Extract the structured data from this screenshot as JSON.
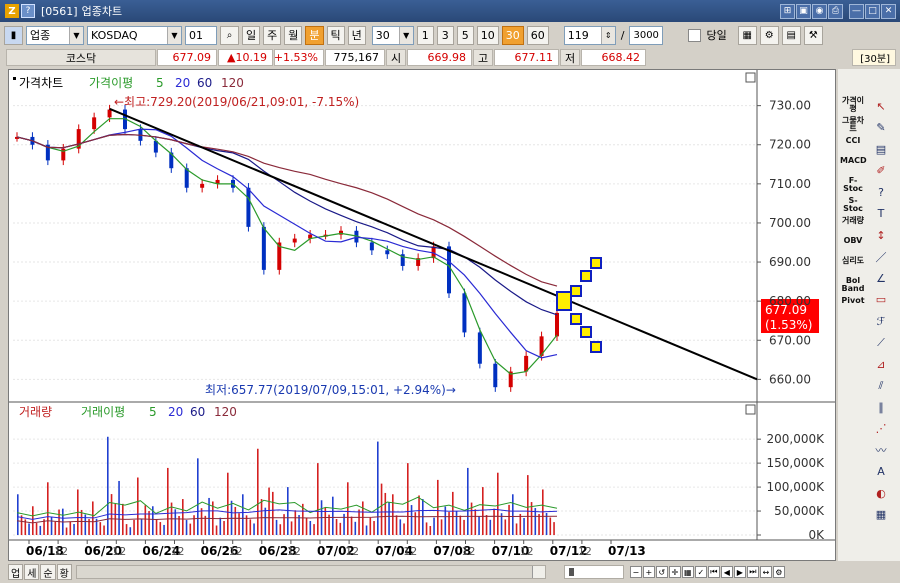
{
  "window": {
    "screen_code": "[0561]",
    "title": "업종차트",
    "logo": "Z",
    "logo2": "?"
  },
  "toolbar": {
    "market_select": "업종",
    "index_select": "KOSDAQ",
    "code_value": "01",
    "periods": [
      "일",
      "주",
      "월",
      "분",
      "틱",
      "년"
    ],
    "active_period": "분",
    "interval_value": "30",
    "intervals": [
      "1",
      "3",
      "5",
      "10",
      "30",
      "60"
    ],
    "active_interval": "30",
    "count_value": "119",
    "slash": "/",
    "total_value": "3000",
    "same_day_label": "당일"
  },
  "pricebar": {
    "name": "코스닥",
    "price": "677.09",
    "change": "▲10.19",
    "change_pct": "+1.53%",
    "volume": "775,167",
    "open_label": "시",
    "open": "669.98",
    "high_label": "고",
    "high": "677.11",
    "low_label": "저",
    "low": "668.42",
    "interval_badge": "[30분]"
  },
  "price_chart": {
    "legend_title": "가격차트",
    "ma_title": "가격이평",
    "ma_periods": [
      "5",
      "20",
      "60",
      "120"
    ],
    "ma_colors": [
      "#2a9a2a",
      "#2a2ad4",
      "#1a1a88",
      "#8a2a3a"
    ],
    "y_ticks": [
      "730.00",
      "720.00",
      "710.00",
      "700.00",
      "690.00",
      "680.00",
      "670.00",
      "660.00"
    ],
    "high_annotation": "←최고:729.20(2019/06/21,09:01, -7.15%)",
    "low_annotation": "최저:657.77(2019/07/09,15:01, +2.94%)→",
    "current_price_label": "677.09",
    "current_pct_label": "(1.53%)"
  },
  "volume_chart": {
    "legend_title": "거래량",
    "ma_title": "거래이평",
    "ma_periods": [
      "5",
      "20",
      "60",
      "120"
    ],
    "y_ticks": [
      "200,000K",
      "150,000K",
      "100,000K",
      "50,000K",
      "0K"
    ]
  },
  "x_axis": {
    "labels": [
      "06/18",
      "12",
      "06/20",
      "12",
      "06/24",
      "12",
      "06/26",
      "12",
      "06/28",
      "12",
      "07/02",
      "12",
      "07/04",
      "12",
      "07/08",
      "12",
      "07/10",
      "12",
      "07/12",
      "12",
      "07/13"
    ]
  },
  "right_panel": {
    "indicators": [
      "가격이평",
      "그물차트",
      "CCI",
      "MACD",
      "F-Stoc",
      "S-Stoc",
      "거래량",
      "OBV",
      "심리도",
      "Bol Band",
      "Pivot"
    ]
  },
  "bottom": {
    "tabs": [
      "업",
      "세",
      "순",
      "황"
    ]
  },
  "chart_data": {
    "type": "line",
    "price_series": {
      "name": "가격차트",
      "x": [
        "06/18 09:00",
        "06/18 12:00",
        "06/19 09:00",
        "06/19 12:00",
        "06/20 09:00",
        "06/20 12:00",
        "06/21 09:00",
        "06/21 12:00",
        "06/24 09:00",
        "06/24 12:00",
        "06/25 09:00",
        "06/25 12:00",
        "06/26 09:00",
        "06/26 12:00",
        "06/27 09:00",
        "06/27 12:00",
        "06/28 09:00",
        "06/28 12:00",
        "07/01 09:00",
        "07/01 12:00",
        "07/02 09:00",
        "07/02 12:00",
        "07/03 09:00",
        "07/03 12:00",
        "07/04 09:00",
        "07/04 12:00",
        "07/05 09:00",
        "07/05 12:00",
        "07/08 09:00",
        "07/08 12:00",
        "07/09 09:00",
        "07/09 15:00",
        "07/10 09:00",
        "07/10 12:00",
        "07/11 09:00",
        "07/11 12:00"
      ],
      "close": [
        722,
        720,
        716,
        719,
        724,
        727,
        729,
        724,
        721,
        718,
        714,
        709,
        710,
        711,
        709,
        699,
        688,
        695,
        696,
        697,
        697,
        698,
        695,
        693,
        692,
        689,
        691,
        694,
        682,
        672,
        664,
        658,
        662,
        666,
        671,
        677
      ]
    },
    "volume_series": {
      "name": "거래량",
      "values_k": [
        85,
        60,
        110,
        55,
        95,
        70,
        205,
        65,
        120,
        60,
        140,
        75,
        160,
        70,
        130,
        85,
        180,
        90,
        100,
        65,
        150,
        80,
        110,
        70,
        195,
        85,
        150,
        75,
        115,
        90,
        140,
        100,
        130,
        85,
        125,
        95
      ]
    },
    "trendline": {
      "from": [
        "06/21 09:00",
        729.2
      ],
      "to": [
        "07/13",
        660
      ]
    },
    "annotations": [
      {
        "text": "최고:729.20(2019/06/21,09:01, -7.15%)",
        "value": 729.2
      },
      {
        "text": "최저:657.77(2019/07/09,15:01, +2.94%)",
        "value": 657.77
      }
    ],
    "ylim_price": [
      656,
      734
    ],
    "ylim_volume_k": [
      0,
      240
    ]
  }
}
